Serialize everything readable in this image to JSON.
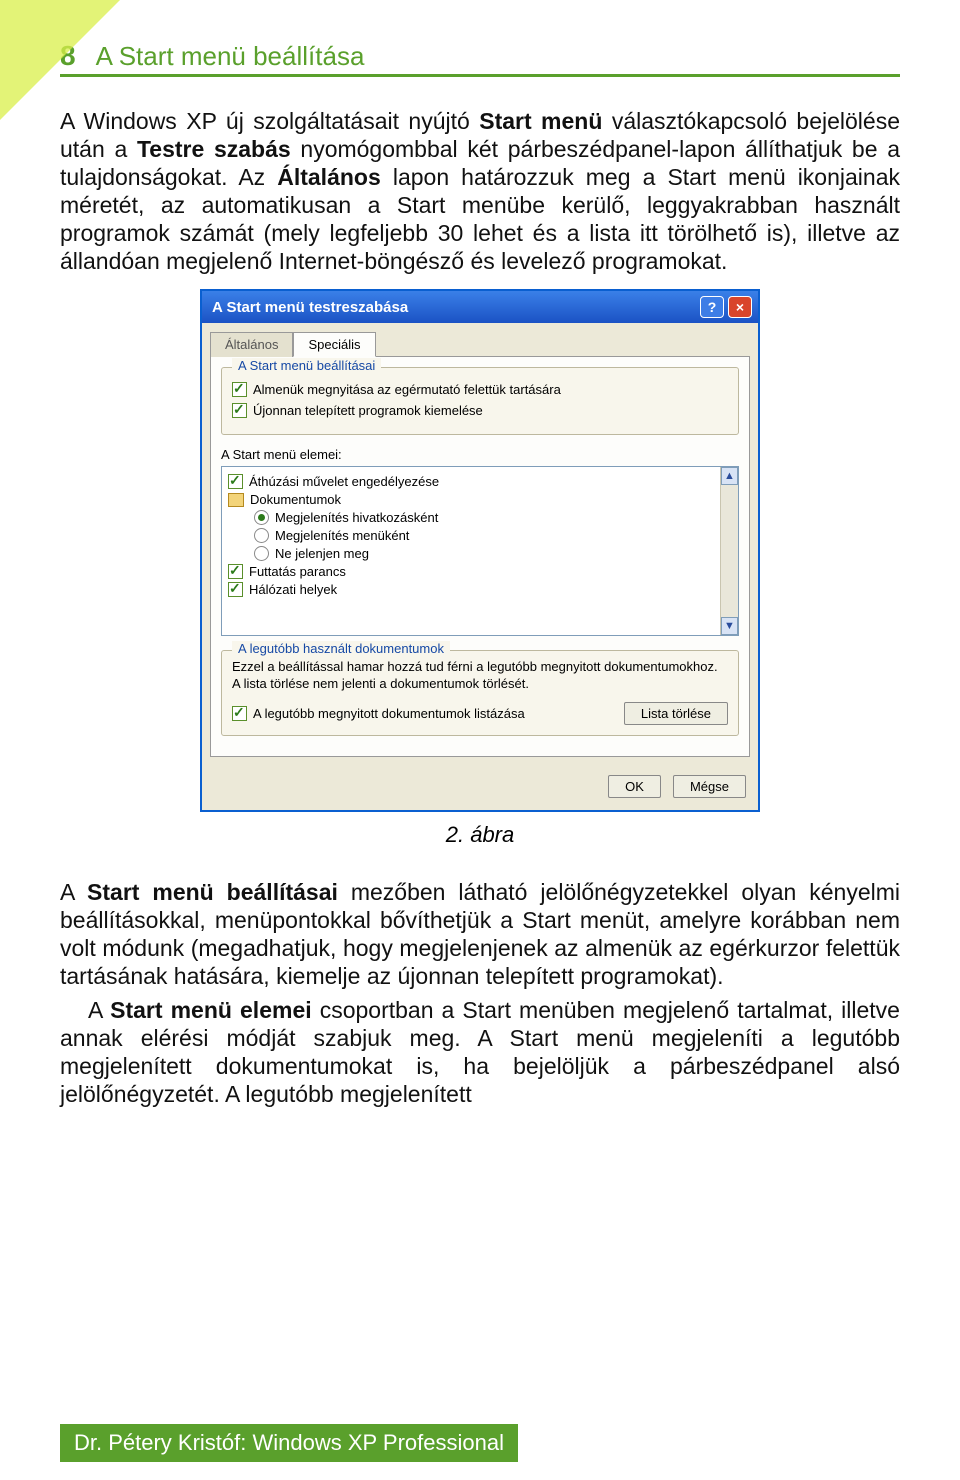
{
  "page": {
    "number": "8",
    "header_title": "A Start menü beállítása"
  },
  "paragraphs": {
    "p1a": "A Windows XP új szolgáltatásait nyújtó ",
    "p1b": "Start menü",
    "p1c": " választókapcsoló bejelölése után a ",
    "p1d": "Testre szabás",
    "p1e": " nyomógombbal két párbeszédpanel-lapon állíthatjuk be a tulajdonságokat. Az ",
    "p1f": "Általános",
    "p1g": " lapon határozzuk meg a Start menü ikonjainak méretét, az automatikusan a Start menübe kerülő, leggyakrabban használt programok számát (mely legfeljebb 30 lehet és a lista itt törölhető is), illetve az állandóan megjelenő Internet-böngésző és levelező programokat."
  },
  "dialog": {
    "title": "A Start menü testreszabása",
    "tabs": {
      "general": "Általános",
      "special": "Speciális"
    },
    "group1_title": "A Start menü beállításai",
    "chk_submenu": "Almenük megnyitása az egérmutató felettük tartására",
    "chk_highlight": "Újonnan telepített programok kiemelése",
    "elements_label": "A Start menü elemei:",
    "list": {
      "item_drag": "Áthúzási művelet engedélyezése",
      "item_docs": "Dokumentumok",
      "opt_link": "Megjelenítés hivatkozásként",
      "opt_menu": "Megjelenítés menüként",
      "opt_none": "Ne jelenjen meg",
      "item_run": "Futtatás parancs",
      "item_net": "Hálózati helyek"
    },
    "group2_title": "A legutóbb használt dokumentumok",
    "group2_desc": "Ezzel a beállítással hamar hozzá tud férni a legutóbb megnyitott dokumentumokhoz. A lista törlése nem jelenti a dokumentumok törlését.",
    "chk_recent": "A legutóbb megnyitott dokumentumok listázása",
    "btn_clear": "Lista törlése",
    "btn_ok": "OK",
    "btn_cancel": "Mégse"
  },
  "caption": "2. ábra",
  "after": {
    "a1": "A ",
    "a2": "Start menü beállításai",
    "a3": " mezőben látható jelölőnégyzetekkel olyan kényelmi beállításokkal, menüpontokkal bővíthetjük a Start menüt, amelyre korábban nem volt módunk (megadhatjuk, hogy megjelenjenek az almenük az egérkurzor felettük tartásának hatására, kiemelje az újonnan telepített programokat).",
    "b1": "A ",
    "b2": "Start menü elemei",
    "b3": " csoportban a Start menüben megjelenő tartalmat, illetve annak elérési módját szabjuk meg. A Start menü megjeleníti a legutóbb megjelenített dokumentumokat is, ha bejelöljük a párbeszédpanel alsó jelölőnégyzetét. A legutóbb megjelenített"
  },
  "footer": "Dr. Pétery Kristóf: Windows XP Professional"
}
